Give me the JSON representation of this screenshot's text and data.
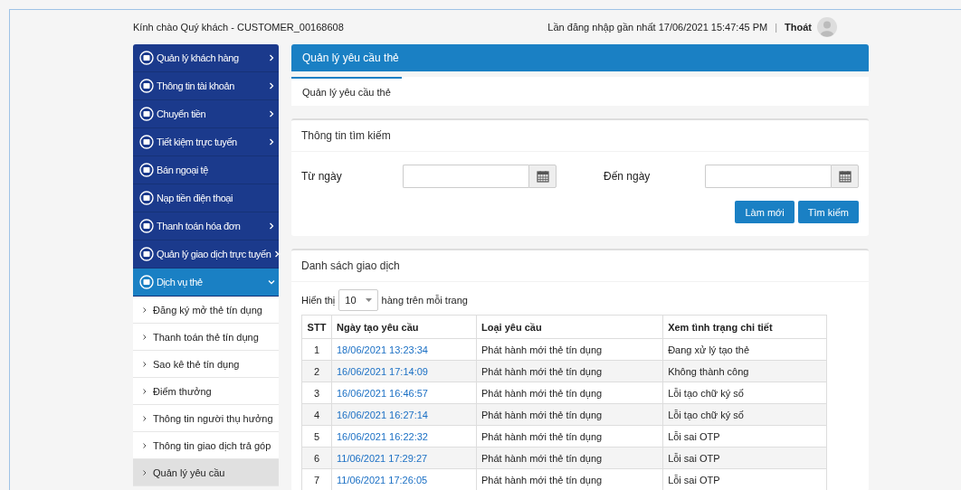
{
  "header": {
    "greeting": "Kính chào Quý khách - CUSTOMER_00168608",
    "last_login": "Lần đăng nhập gần nhất 17/06/2021 15:47:45 PM",
    "separator": "|",
    "logout": "Thoát"
  },
  "sidebar": {
    "items": [
      {
        "label": "Quản lý khách hàng",
        "has_arrow": true,
        "expanded": false,
        "selected": false
      },
      {
        "label": "Thông tin tài khoản",
        "has_arrow": true,
        "expanded": false,
        "selected": false
      },
      {
        "label": "Chuyển tiền",
        "has_arrow": true,
        "expanded": false,
        "selected": false
      },
      {
        "label": "Tiết kiệm trực tuyến",
        "has_arrow": true,
        "expanded": false,
        "selected": false
      },
      {
        "label": "Bán ngoại tệ",
        "has_arrow": false,
        "selected": false
      },
      {
        "label": "Nạp tiền điện thoại",
        "has_arrow": false,
        "selected": false
      },
      {
        "label": "Thanh toán hóa đơn",
        "has_arrow": true,
        "expanded": false,
        "selected": false
      },
      {
        "label": "Quản lý giao dịch trực tuyến",
        "has_arrow": true,
        "expanded": false,
        "selected": false
      },
      {
        "label": "Dịch vụ thẻ",
        "has_arrow": true,
        "expanded": true,
        "selected": true,
        "children": [
          {
            "label": "Đăng ký mở thẻ tín dụng",
            "selected": false
          },
          {
            "label": "Thanh toán thẻ tín dụng",
            "selected": false
          },
          {
            "label": "Sao kê thẻ tín dụng",
            "selected": false
          },
          {
            "label": "Điểm thưởng",
            "selected": false
          },
          {
            "label": "Thông tin người thụ hưởng",
            "selected": false
          },
          {
            "label": "Thông tin giao dịch trả góp",
            "selected": false
          },
          {
            "label": "Quản lý yêu cầu",
            "selected": true
          }
        ]
      }
    ]
  },
  "page_title": "Quản lý yêu cầu thẻ",
  "tabs": [
    {
      "label": "Quản lý yêu cầu thẻ",
      "selected": true
    }
  ],
  "search": {
    "title": "Thông tin tìm kiếm",
    "from_label": "Từ ngày",
    "to_label": "Đến ngày",
    "buttons": [
      "Làm mới",
      "Tìm kiếm"
    ]
  },
  "list": {
    "title": "Danh sách giao dịch",
    "show_label": "Hiển thị",
    "page_size": "10",
    "per_page_label": "hàng trên mỗi trang",
    "columns": [
      "STT",
      "Ngày tạo yêu cầu",
      "Loại yêu cầu",
      "Xem tình trạng chi tiết"
    ],
    "rows": [
      [
        "1",
        "18/06/2021 13:23:34",
        "Phát hành mới thẻ tín dụng",
        "Đang xử lý tạo thẻ"
      ],
      [
        "2",
        "16/06/2021 17:14:09",
        "Phát hành mới thẻ tín dụng",
        "Không thành công"
      ],
      [
        "3",
        "16/06/2021 16:46:57",
        "Phát hành mới thẻ tín dụng",
        "Lỗi tạo chữ ký số"
      ],
      [
        "4",
        "16/06/2021 16:27:14",
        "Phát hành mới thẻ tín dụng",
        "Lỗi tạo chữ ký số"
      ],
      [
        "5",
        "16/06/2021 16:22:32",
        "Phát hành mới thẻ tín dụng",
        "Lỗi sai OTP"
      ],
      [
        "6",
        "11/06/2021 17:29:27",
        "Phát hành mới thẻ tín dụng",
        "Lỗi sai OTP"
      ],
      [
        "7",
        "11/06/2021 17:26:05",
        "Phát hành mới thẻ tín dụng",
        "Lỗi sai OTP"
      ]
    ]
  }
}
